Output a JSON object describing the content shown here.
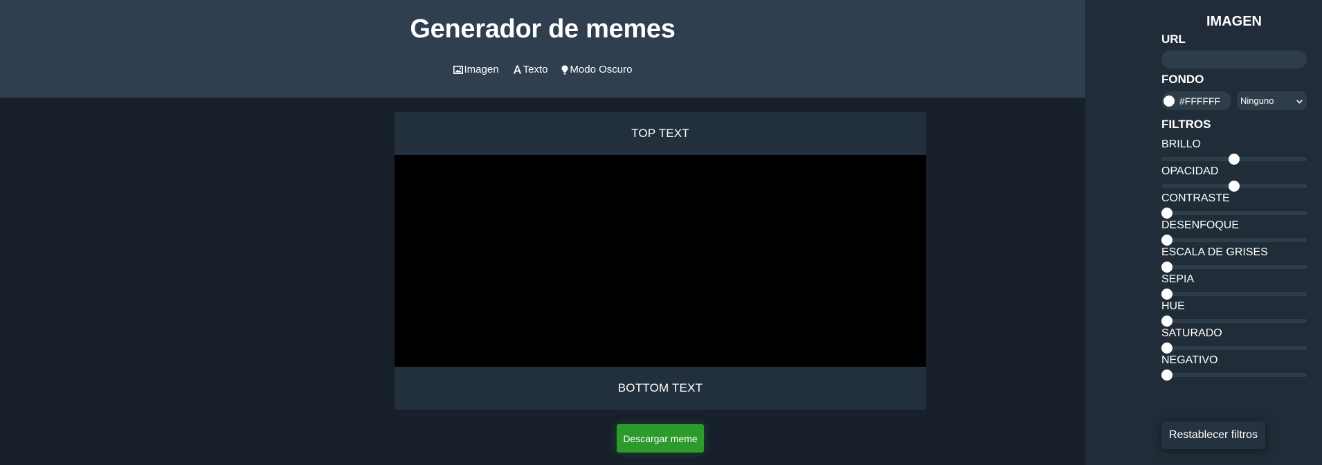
{
  "header": {
    "title": "Generador de memes",
    "nav": [
      {
        "label": "Imagen",
        "icon": "image-icon"
      },
      {
        "label": "Texto",
        "icon": "text-icon"
      },
      {
        "label": "Modo Oscuro",
        "icon": "lightbulb-icon"
      }
    ]
  },
  "meme": {
    "top_text": "TOP TEXT",
    "bottom_text": "BOTTOM TEXT",
    "download_label": "Descargar meme"
  },
  "panel": {
    "title": "IMAGEN",
    "url_label": "URL",
    "url_value": "",
    "fondo_label": "FONDO",
    "fondo_color": "#FFFFFF",
    "blend_mode": "Ninguno",
    "filtros_label": "FILTROS",
    "filters": [
      {
        "label": "BRILLO",
        "fraction": 0.5
      },
      {
        "label": "OPACIDAD",
        "fraction": 0.5
      },
      {
        "label": "CONTRASTE",
        "fraction": 0
      },
      {
        "label": "DESENFOQUE",
        "fraction": 0
      },
      {
        "label": "ESCALA DE GRISES",
        "fraction": 0
      },
      {
        "label": "SEPIA",
        "fraction": 0
      },
      {
        "label": "HUE",
        "fraction": 0
      },
      {
        "label": "SATURADO",
        "fraction": 0
      },
      {
        "label": "NEGATIVO",
        "fraction": 0
      }
    ],
    "reset_label": "Restablecer filtros"
  },
  "colors": {
    "header_bg": "#2f3f4f",
    "page_bg": "#17202b",
    "sidebar_bg": "#202c38",
    "download_green": "#2b9b2b"
  }
}
